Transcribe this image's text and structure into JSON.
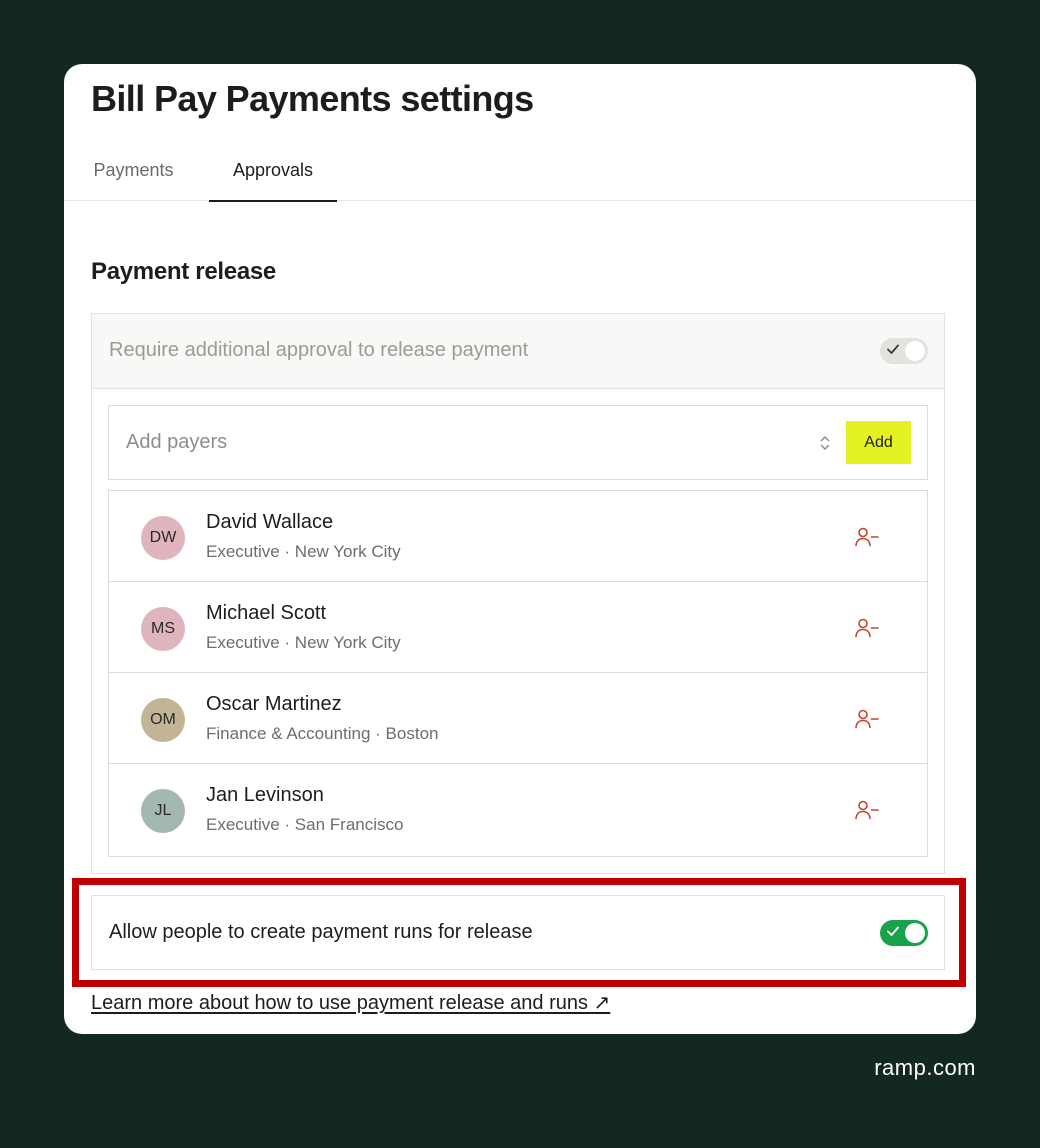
{
  "page": {
    "title": "Bill Pay Payments settings"
  },
  "tabs": [
    {
      "label": "Payments",
      "active": false
    },
    {
      "label": "Approvals",
      "active": true
    }
  ],
  "payment_release": {
    "section_title": "Payment release",
    "require_label": "Require additional approval to release payment",
    "require_toggle": "on (disabled)",
    "payer_select": {
      "placeholder": "Add payers",
      "add_label": "Add"
    },
    "people": [
      {
        "initials": "DW",
        "name": "David Wallace",
        "meta": "Executive · New York City",
        "avatar_color": "#e0b4bd"
      },
      {
        "initials": "MS",
        "name": "Michael Scott",
        "meta": "Executive · New York City",
        "avatar_color": "#e0b4bd"
      },
      {
        "initials": "OM",
        "name": "Oscar Martinez",
        "meta": "Finance & Accounting · Boston",
        "avatar_color": "#c2b596"
      },
      {
        "initials": "JL",
        "name": "Jan Levinson",
        "meta": "Executive · San Francisco",
        "avatar_color": "#a4b8b3"
      }
    ]
  },
  "payment_runs": {
    "label": "Allow people to create payment runs for release",
    "toggle": "on"
  },
  "learn_more": "Learn more about how to use payment release and runs ↗",
  "brand": "ramp.com",
  "colors": {
    "background": "#132723",
    "accent_button": "#e4f222",
    "toggle_on": "#18a34a",
    "remove_icon": "#c4432a",
    "highlight_border": "#c00000"
  },
  "icons": {
    "remove": "person-minus-icon",
    "chevrons": "chevron-up-down-icon",
    "check": "check-icon"
  }
}
